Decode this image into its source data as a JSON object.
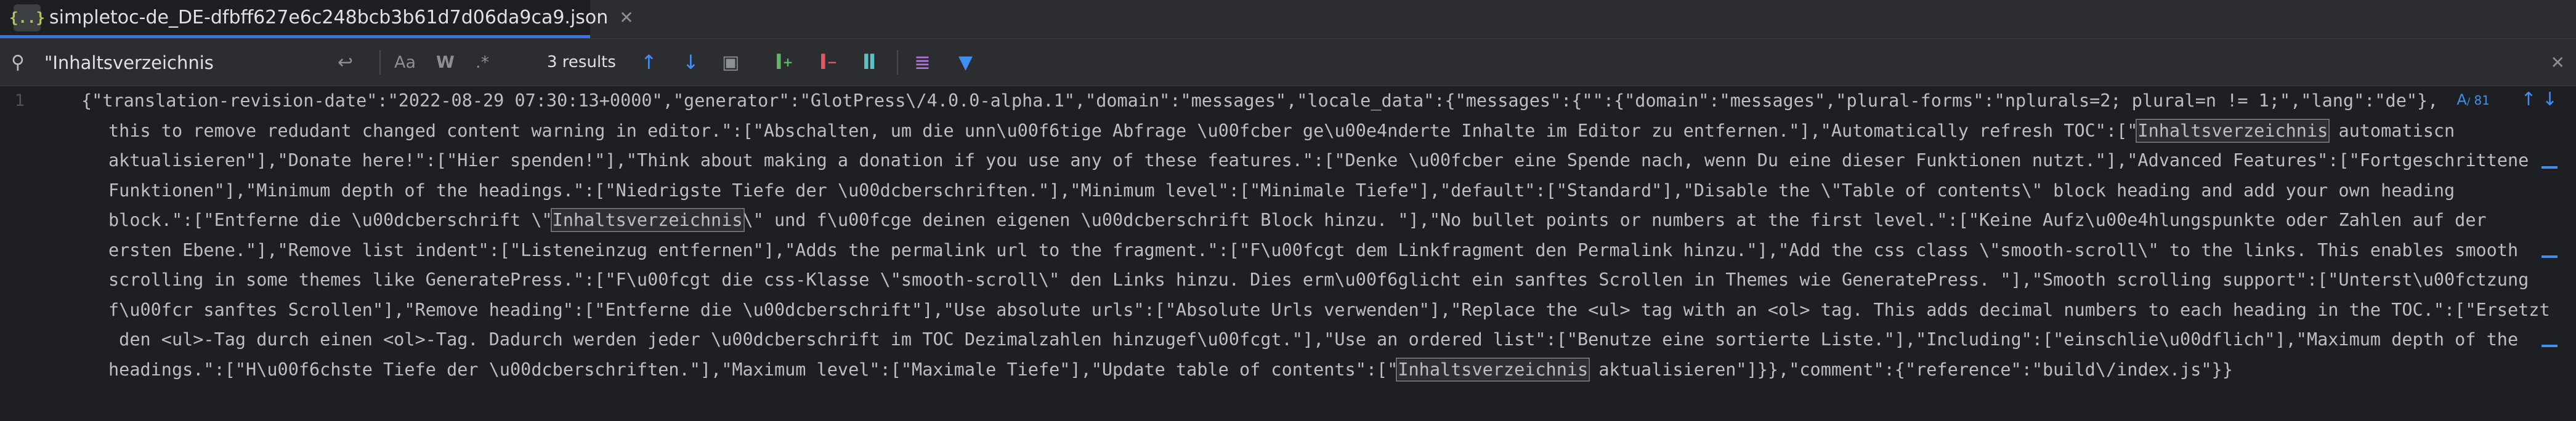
{
  "tab": {
    "icon_label": "{..}",
    "filename": "simpletoc-de_DE-dfbff627e6c248bcb3b61d7d06da9ca9.json",
    "close_glyph": "✕"
  },
  "find": {
    "query": "\"Inhaltsverzeichnis",
    "case_label": "Aa",
    "word_label": "W",
    "regex_label": ".*",
    "results": "3 results",
    "close_glyph": "✕"
  },
  "editor": {
    "line_number": "1",
    "inlay_label": "81",
    "lines": [
      [
        "{\"translation-revision-date\":\"2022-08-29 07:30:13+0000\",\"generator\":\"GlotPress\\/4.0.0-alpha.1\",\"domain\":\"messages\",\"locale_data\":{\"messages\":{\"\":{\"domain\":\"messages\",\"plural-forms\":\"nplurals=2; plural=n != 1;\",\"lang\":\"de\"},"
      ],
      [
        "this to remove redudant changed content warning in editor.\":[\"Abschalten, um die unn\\u00f6tige Abfrage \\u00fcber ge\\u00e4nderte Inhalte im Editor zu entfernen.\"],\"Automatically refresh TOC\":[\"",
        "Inhaltsverzeichnis",
        " automatiscn"
      ],
      [
        "aktualisieren\"],\"Donate here!\":[\"Hier spenden!\"],\"Think about making a donation if you use any of these features.\":[\"Denke \\u00fcber eine Spende nach, wenn Du eine dieser Funktionen nutzt.\"],\"Advanced Features\":[\"Fortgeschrittene"
      ],
      [
        "Funktionen\"],\"Minimum depth of the headings.\":[\"Niedrigste Tiefe der \\u00dcberschriften.\"],\"Minimum level\":[\"Minimale Tiefe\"],\"default\":[\"Standard\"],\"Disable the \\\"Table of contents\\\" block heading and add your own heading"
      ],
      [
        "block.\":[\"Entferne die \\u00dcberschrift \\\"",
        "Inhaltsverzeichnis",
        "\\\" und f\\u00fcge deinen eigenen \\u00dcberschrift Block hinzu. \"],\"No bullet points or numbers at the first level.\":[\"Keine Aufz\\u00e4hlungspunkte oder Zahlen auf der"
      ],
      [
        "ersten Ebene.\"],\"Remove list indent\":[\"Listeneinzug entfernen\"],\"Adds the permalink url to the fragment.\":[\"F\\u00fcgt dem Linkfragment den Permalink hinzu.\"],\"Add the css class \\\"smooth-scroll\\\" to the links. This enables smooth"
      ],
      [
        "scrolling in some themes like GeneratePress.\":[\"F\\u00fcgt die css-Klasse \\\"smooth-scroll\\\" den Links hinzu. Dies erm\\u00f6glicht ein sanftes Scrollen in Themes wie GeneratePress. \"],\"Smooth scrolling support\":[\"Unterst\\u00fctzung"
      ],
      [
        "f\\u00fcr sanftes Scrollen\"],\"Remove heading\":[\"Entferne die \\u00dcberschrift\"],\"Use absolute urls\":[\"Absolute Urls verwenden\"],\"Replace the <ul> tag with an <ol> tag. This adds decimal numbers to each heading in the TOC.\":[\"Ersetzt"
      ],
      [
        " den <ul>-Tag durch einen <ol>-Tag. Dadurch werden jeder \\u00dcberschrift im TOC Dezimalzahlen hinzugef\\u00fcgt.\"],\"Use an ordered list\":[\"Benutze eine sortierte Liste.\"],\"Including\":[\"einschlie\\u00dflich\"],\"Maximum depth of the"
      ],
      [
        "headings.\":[\"H\\u00f6chste Tiefe der \\u00dcberschriften.\"],\"Maximum level\":[\"Maximale Tiefe\"],\"Update table of contents\":[\"",
        "Inhaltsverzeichnis",
        " aktualisieren\"]}},\"comment\":{\"reference\":\"build\\/index.js\"}}"
      ]
    ]
  },
  "colors": {
    "accent": "#3574f0",
    "background": "#1e1f22",
    "panel": "#2b2d30"
  }
}
